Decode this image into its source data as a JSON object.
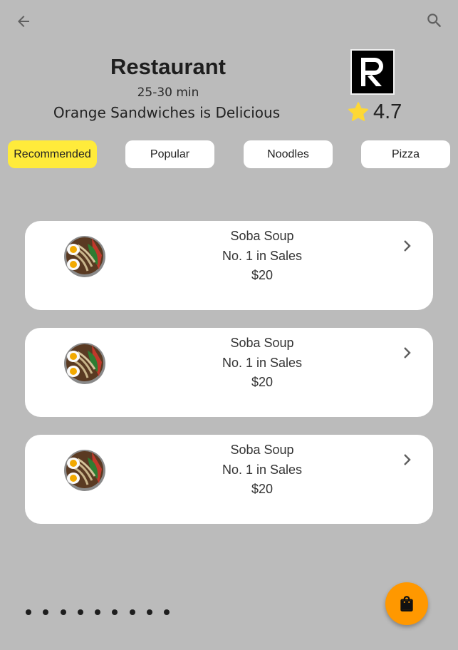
{
  "header": {
    "back_icon": "arrow-back-icon",
    "search_icon": "search-icon"
  },
  "restaurant": {
    "title": "Restaurant",
    "delivery_time": "25-30 min",
    "description": "Orange Sandwiches is Delicious",
    "logo_icon": "restaurant-logo-icon",
    "rating": "4.7",
    "rating_icon": "star-icon",
    "star_color": "#fdd835"
  },
  "tabs": [
    {
      "label": "Recommended",
      "active": true
    },
    {
      "label": "Popular",
      "active": false
    },
    {
      "label": "Noodles",
      "active": false
    },
    {
      "label": "Pizza",
      "active": false
    }
  ],
  "items": [
    {
      "name": "Soba Soup",
      "tagline": "No. 1 in Sales",
      "price": "$20"
    },
    {
      "name": "Soba Soup",
      "tagline": "No. 1 in Sales",
      "price": "$20"
    },
    {
      "name": "Soba Soup",
      "tagline": "No. 1 in Sales",
      "price": "$20"
    }
  ],
  "pager": {
    "count": 9
  },
  "cart": {
    "icon": "shopping-bag-icon",
    "color": "#ff9800"
  },
  "colors": {
    "background": "#bbbbbb",
    "active_tab": "#ffeb3b",
    "card": "#ffffff"
  }
}
